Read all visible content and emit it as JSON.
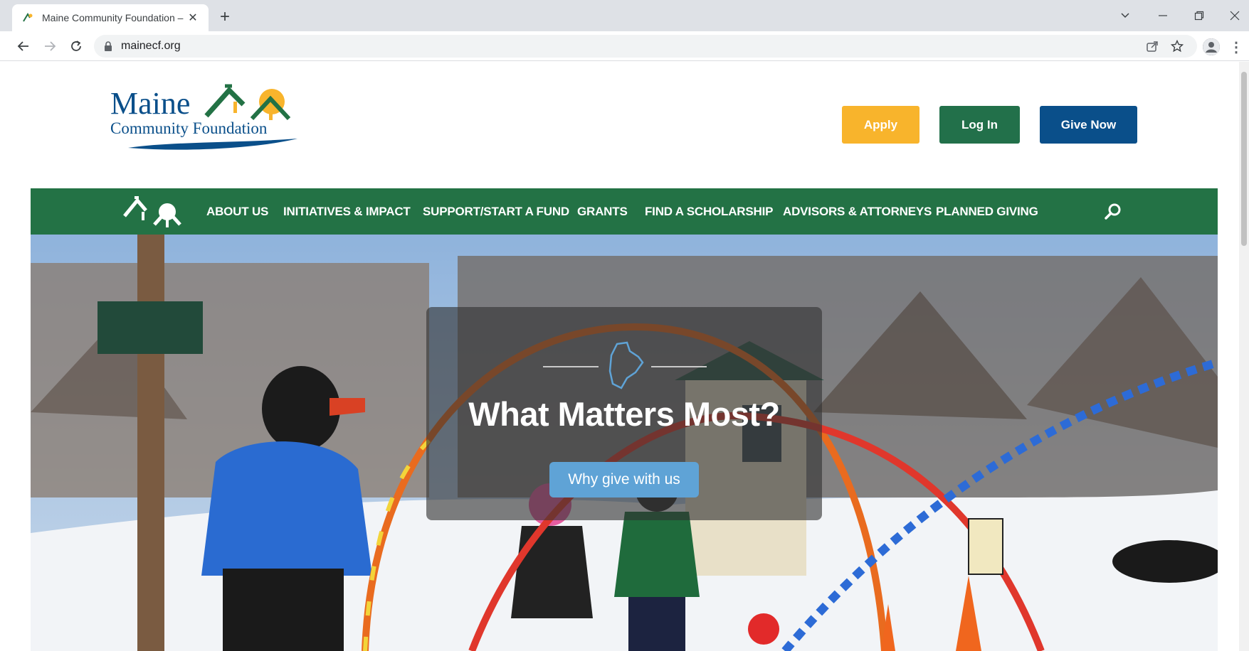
{
  "browser": {
    "tab_title": "Maine Community Foundation –",
    "url": "mainecf.org"
  },
  "header": {
    "logo_line1": "Maine",
    "logo_line2": "Community Foundation",
    "buttons": {
      "apply": "Apply",
      "login": "Log In",
      "give": "Give Now"
    }
  },
  "nav": {
    "items": [
      {
        "label": "ABOUT US"
      },
      {
        "label": "INITIATIVES & IMPACT"
      },
      {
        "label": "SUPPORT/START A FUND"
      },
      {
        "label": "GRANTS"
      },
      {
        "label": "FIND A SCHOLARSHIP"
      },
      {
        "label": "ADVISORS & ATTORNEYS"
      },
      {
        "label": "PLANNED GIVING"
      }
    ]
  },
  "hero": {
    "title": "What Matters Most?",
    "button": "Why give with us"
  },
  "colors": {
    "brand_green": "#237245",
    "brand_blue": "#0a4f8a",
    "apply_yellow": "#f8b42c",
    "hero_button": "#5fa3d6"
  },
  "icons": [
    "tab-favicon-icon",
    "close-icon",
    "plus-icon",
    "chevron-down-icon",
    "minimize-icon",
    "restore-icon",
    "close-window-icon",
    "back-arrow-icon",
    "forward-arrow-icon",
    "reload-icon",
    "lock-icon",
    "share-icon",
    "bookmark-star-icon",
    "profile-icon",
    "kebab-menu-icon",
    "search-icon",
    "maine-state-icon"
  ]
}
